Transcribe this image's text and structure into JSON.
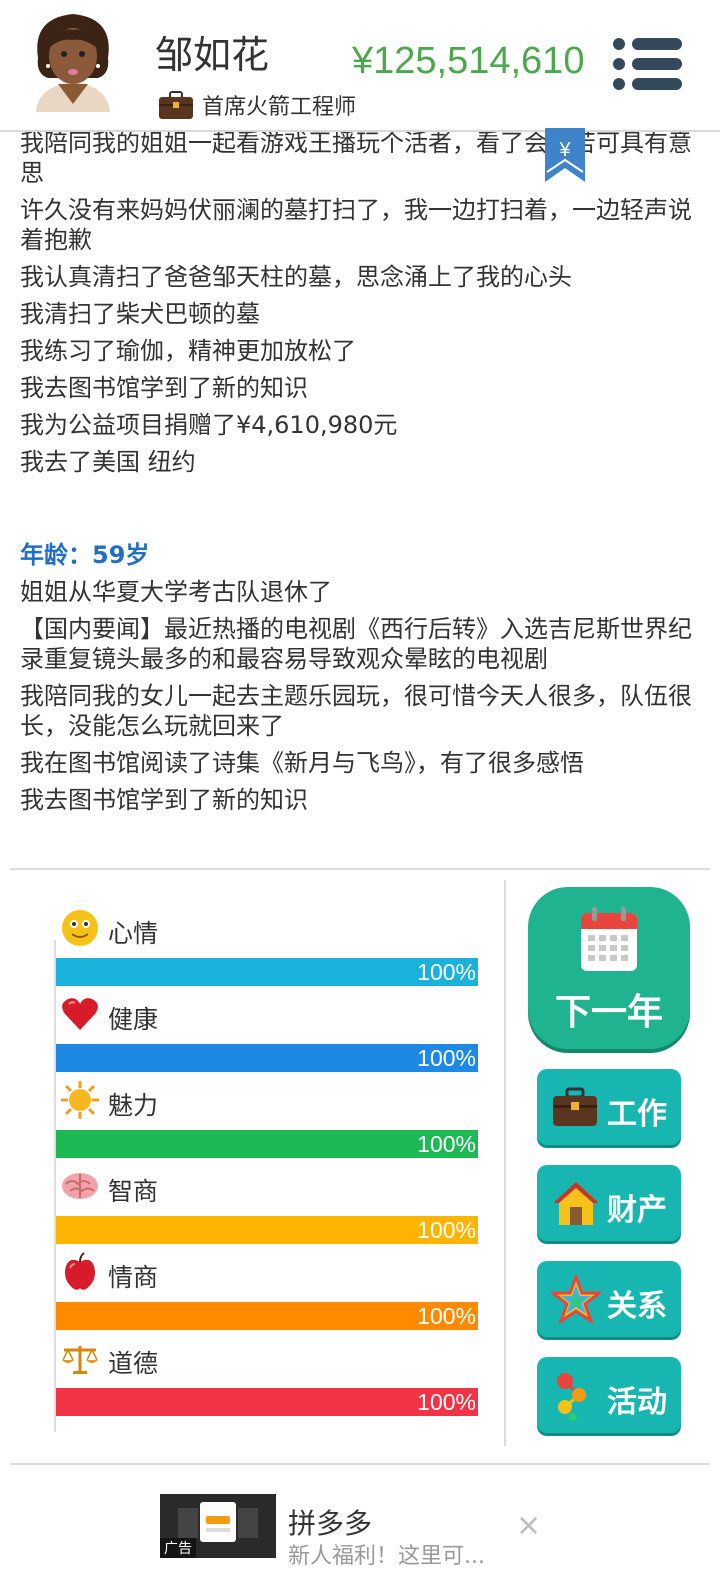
{
  "header": {
    "name": "邹如花",
    "job": "首席火箭工程师",
    "money": "¥125,514,610",
    "menu_icon": "hamburger-menu-icon",
    "bookmark_icon": "yuan-bookmark-icon",
    "bookmark_glyph": "¥"
  },
  "log": {
    "lines_before": [
      "我陪同我的姐姐一起看游戏王播玩个活者，看了会觉苦可具有意思",
      "许久没有来妈妈伏丽澜的墓打扫了，我一边打扫着，一边轻声说着抱歉",
      "我认真清扫了爸爸邹天柱的墓，思念涌上了我的心头",
      "我清扫了柴犬巴顿的墓",
      "我练习了瑜伽，精神更加放松了",
      "我去图书馆学到了新的知识",
      "我为公益项目捐赠了¥4,610,980元",
      "我去了美国 纽约"
    ],
    "age_label": "年龄：59岁",
    "lines_after": [
      "姐姐从华夏大学考古队退休了",
      "【国内要闻】最近热播的电视剧《西行后转》入选吉尼斯世界纪录重复镜头最多的和最容易导致观众晕眩的电视剧",
      "我陪同我的女儿一起去主题乐园玩，很可惜今天人很多，队伍很长，没能怎么玩就回来了",
      "我在图书馆阅读了诗集《新月与飞鸟》，有了很多感悟",
      "我去图书馆学到了新的知识"
    ]
  },
  "stats": [
    {
      "label": "心情",
      "value": "100%",
      "fill": 1.0,
      "color": "#1ab2db",
      "icon": "smiley-face-icon"
    },
    {
      "label": "健康",
      "value": "100%",
      "fill": 1.0,
      "color": "#1e88e5",
      "icon": "heart-icon"
    },
    {
      "label": "魅力",
      "value": "100%",
      "fill": 1.0,
      "color": "#1db954",
      "icon": "sun-icon"
    },
    {
      "label": "智商",
      "value": "100%",
      "fill": 1.0,
      "color": "#ffb400",
      "icon": "brain-icon"
    },
    {
      "label": "情商",
      "value": "100%",
      "fill": 1.0,
      "color": "#ff8a00",
      "icon": "apple-icon"
    },
    {
      "label": "道德",
      "value": "100%",
      "fill": 1.0,
      "color": "#f03345",
      "icon": "scales-icon"
    }
  ],
  "actions": {
    "next_year": "下一年",
    "work": "工作",
    "assets": "财产",
    "relations": "关系",
    "activities": "活动"
  },
  "ad": {
    "title": "拼多多",
    "subtitle": "新人福利！这里可...",
    "tag": "广告",
    "close_glyph": "×"
  }
}
